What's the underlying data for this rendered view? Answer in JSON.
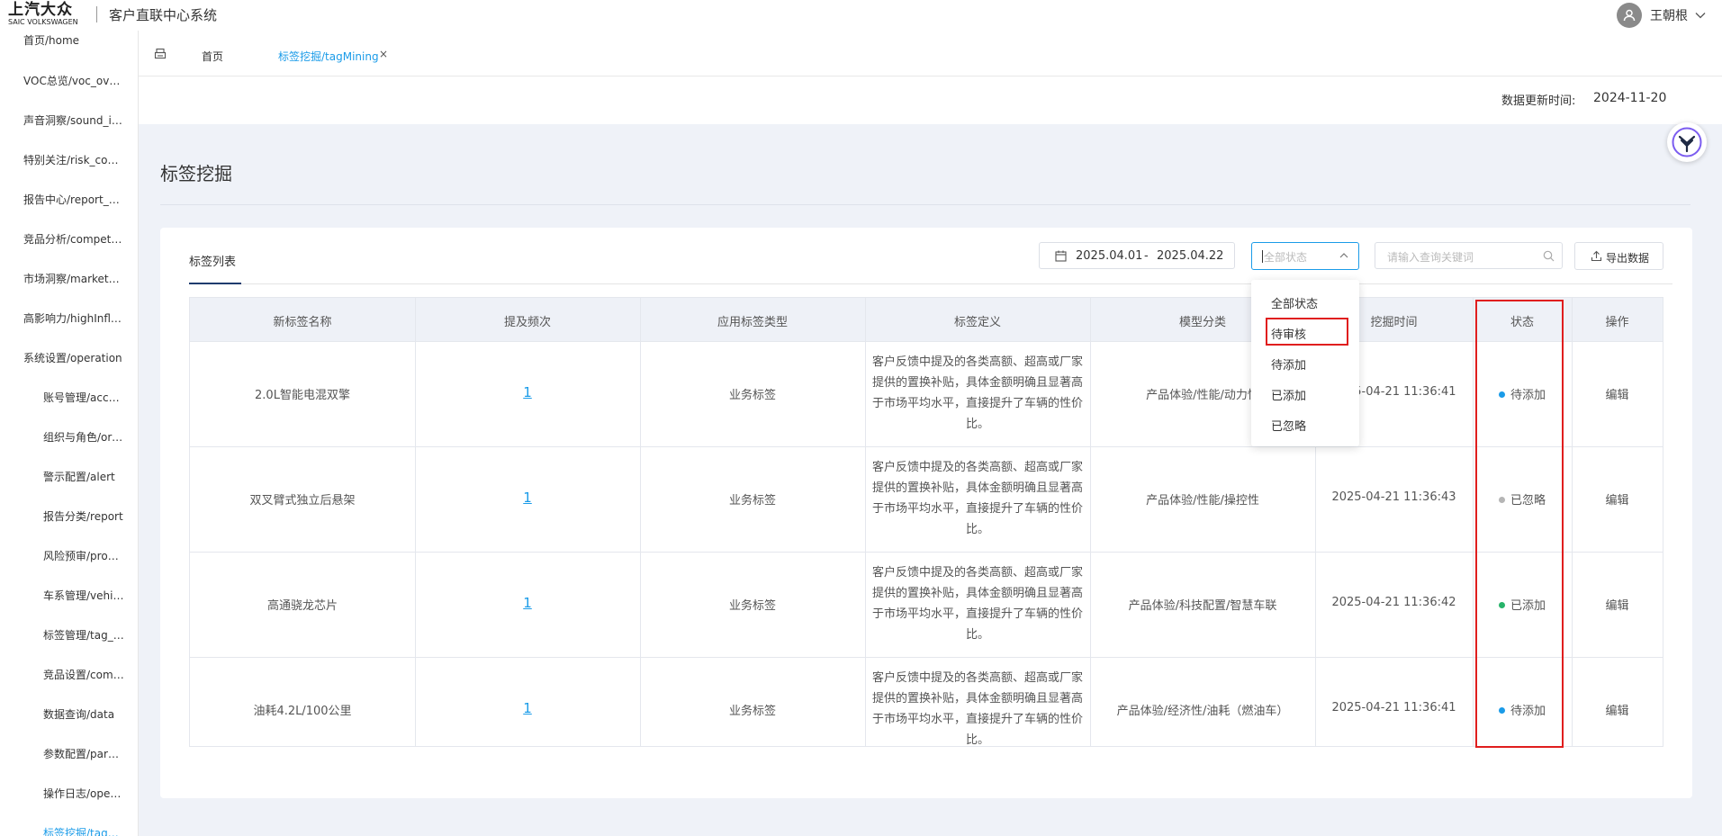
{
  "header": {
    "logo_cn": "上汽大众",
    "logo_en": "SAIC VOLKSWAGEN",
    "system_title": "客户直联中心系统",
    "user_name": "王朝根"
  },
  "sidebar": {
    "items": [
      {
        "label": "首页/home",
        "level": "top"
      },
      {
        "label": "VOC总览/voc_overview",
        "level": "top"
      },
      {
        "label": "声音洞察/sound_insight",
        "level": "top"
      },
      {
        "label": "特别关注/risk_control",
        "level": "top"
      },
      {
        "label": "报告中心/report_center",
        "level": "top"
      },
      {
        "label": "竞品分析/competition",
        "level": "top"
      },
      {
        "label": "市场洞察/market_insight",
        "level": "top"
      },
      {
        "label": "高影响力/highInfluence",
        "level": "top"
      },
      {
        "label": "系统设置/operation",
        "level": "top"
      },
      {
        "label": "账号管理/account",
        "level": "sub"
      },
      {
        "label": "组织与角色/organization",
        "level": "sub"
      },
      {
        "label": "警示配置/alert",
        "level": "sub"
      },
      {
        "label": "报告分类/report",
        "level": "sub"
      },
      {
        "label": "风险预审/problem",
        "level": "sub"
      },
      {
        "label": "车系管理/vehicle",
        "level": "sub"
      },
      {
        "label": "标签管理/tag_manage",
        "level": "sub"
      },
      {
        "label": "竞品设置/competition",
        "level": "sub"
      },
      {
        "label": "数据查询/data",
        "level": "sub"
      },
      {
        "label": "参数配置/parameter",
        "level": "sub"
      },
      {
        "label": "操作日志/operation",
        "level": "sub"
      },
      {
        "label": "标签挖掘/tagMining",
        "level": "sub",
        "active": true
      }
    ]
  },
  "tabs": {
    "home": "首页",
    "active": "标签挖掘/tagMining",
    "close": "×"
  },
  "update": {
    "label": "数据更新时间:",
    "value": "2024-11-20"
  },
  "page": {
    "title": "标签挖掘",
    "card_tab": "标签列表"
  },
  "filters": {
    "date_start": "2025.04.01",
    "date_sep": "-",
    "date_end": "2025.04.22",
    "status_placeholder": "全部状态",
    "search_placeholder": "请输入查询关键词",
    "export_label": "导出数据"
  },
  "dropdown": {
    "options": [
      "全部状态",
      "待审核",
      "待添加",
      "已添加",
      "已忽略"
    ],
    "highlighted": "待审核"
  },
  "table": {
    "columns": [
      "新标签名称",
      "提及频次",
      "应用标签类型",
      "标签定义",
      "模型分类",
      "挖掘时间",
      "状态",
      "操作"
    ],
    "rows": [
      {
        "name": "2.0L智能电混双擎",
        "freq": "1",
        "type": "业务标签",
        "definition": "客户反馈中提及的各类高额、超高或厂家提供的置换补贴，具体金额明确且显著高于市场平均水平，直接提升了车辆的性价比。",
        "model": "产品体验/性能/动力性",
        "time": "2025-04-21 11:36:41",
        "status": "待添加",
        "status_color": "#1a9be8",
        "action": "编辑"
      },
      {
        "name": "双叉臂式独立后悬架",
        "freq": "1",
        "type": "业务标签",
        "definition": "客户反馈中提及的各类高额、超高或厂家提供的置换补贴，具体金额明确且显著高于市场平均水平，直接提升了车辆的性价比。",
        "model": "产品体验/性能/操控性",
        "time": "2025-04-21 11:36:43",
        "status": "已忽略",
        "status_color": "#b5b5b5",
        "action": "编辑"
      },
      {
        "name": "高通骁龙芯片",
        "freq": "1",
        "type": "业务标签",
        "definition": "客户反馈中提及的各类高额、超高或厂家提供的置换补贴，具体金额明确且显著高于市场平均水平，直接提升了车辆的性价比。",
        "model": "产品体验/科技配置/智慧车联",
        "time": "2025-04-21 11:36:42",
        "status": "已添加",
        "status_color": "#27b36a",
        "action": "编辑"
      },
      {
        "name": "油耗4.2L/100公里",
        "freq": "1",
        "type": "业务标签",
        "definition": "客户反馈中提及的各类高额、超高或厂家提供的置换补贴，具体金额明确且显著高于市场平均水平，直接提升了车辆的性价比。",
        "model": "产品体验/经济性/油耗（燃油车）",
        "time": "2025-04-21 11:36:41",
        "status": "待添加",
        "status_color": "#1a9be8",
        "action": "编辑"
      }
    ]
  },
  "colors": {
    "accent": "#1a9be8",
    "highlight_border": "#e01e1e"
  }
}
